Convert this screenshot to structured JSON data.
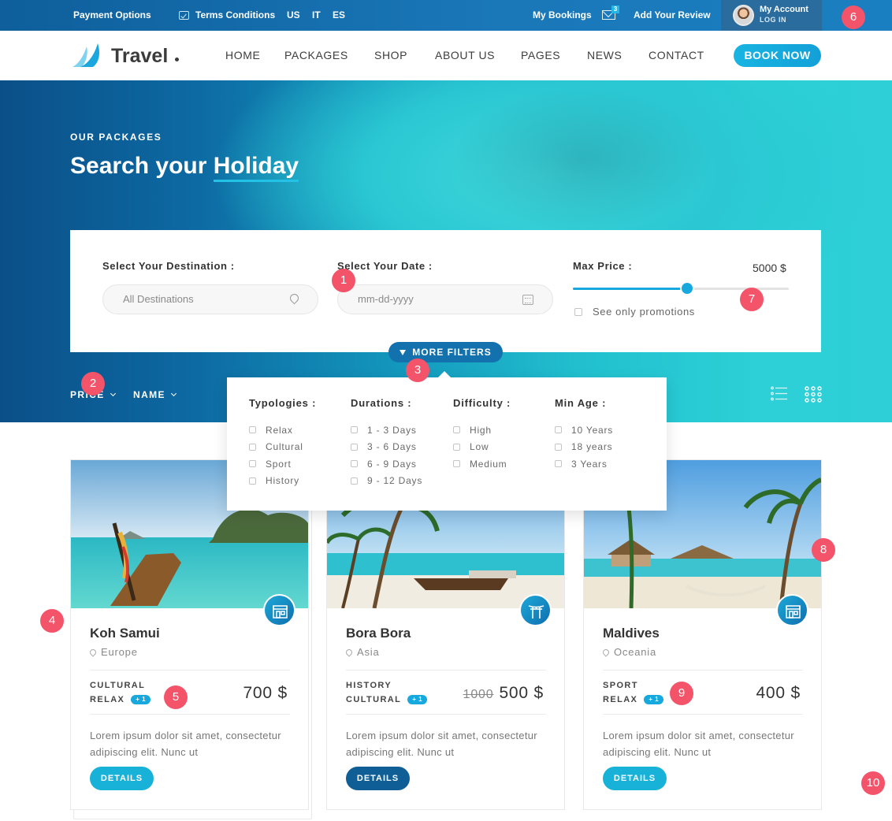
{
  "topbar": {
    "payment_label": "Payment Options",
    "terms_label": "Terms Conditions",
    "languages": [
      "US",
      "IT",
      "ES"
    ],
    "bookings_label": "My Bookings",
    "mail_count": "3",
    "review_label": "Add Your Review",
    "account_label": "My Account",
    "login_label": "LOG IN"
  },
  "nav": {
    "logo_text": "Travel",
    "links": [
      "HOME",
      "PACKAGES",
      "SHOP",
      "ABOUT US",
      "PAGES",
      "NEWS",
      "CONTACT"
    ],
    "cta_label": "BOOK NOW"
  },
  "hero": {
    "subtitle": "OUR PACKAGES",
    "title_plain": "Search your",
    "title_highlight": "Holiday"
  },
  "search": {
    "destination_label": "Select Your Destination :",
    "destination_value": "All Destinations",
    "date_label": "Select Your Date :",
    "date_placeholder": "mm-dd-yyyy",
    "price_label": "Max Price :",
    "price_value": "5000 $",
    "price_slider_fraction": 0.53,
    "promotions_label": "See only promotions",
    "more_filters_label": "MORE FILTERS"
  },
  "sort": {
    "price_label": "PRICE",
    "name_label": "NAME"
  },
  "filters": {
    "columns": [
      {
        "title": "Typologies :",
        "options": [
          "Relax",
          "Cultural",
          "Sport",
          "History"
        ]
      },
      {
        "title": "Durations :",
        "options": [
          "1 - 3 Days",
          "3 - 6 Days",
          "6 - 9 Days",
          "9 - 12 Days"
        ]
      },
      {
        "title": "Difficulty :",
        "options": [
          "High",
          "Low",
          "Medium"
        ]
      },
      {
        "title": "Min Age :",
        "options": [
          "10 Years",
          "18 years",
          "3 Years"
        ]
      }
    ]
  },
  "cards": [
    {
      "name": "Koh Samui",
      "location": "Europe",
      "tag1": "CULTURAL",
      "tag2": "RELAX",
      "more": "+ 1",
      "old_price": "",
      "price": "700 $",
      "description": "Lorem ipsum dolor sit amet, consectetur adipiscing elit. Nunc ut",
      "button": "DETAILS",
      "icon": "shop-icon"
    },
    {
      "name": "Bora Bora",
      "location": "Asia",
      "tag1": "HISTORY",
      "tag2": "CULTURAL",
      "more": "+ 1",
      "old_price": "1000",
      "price": "500 $",
      "description": "Lorem ipsum dolor sit amet, consectetur adipiscing elit. Nunc ut",
      "button": "DETAILS",
      "icon": "torii-gate-icon"
    },
    {
      "name": "Maldives",
      "location": "Oceania",
      "tag1": "SPORT",
      "tag2": "RELAX",
      "more": "+ 1",
      "old_price": "",
      "price": "400 $",
      "description": "Lorem ipsum dolor sit amet, consectetur adipiscing elit. Nunc ut",
      "button": "DETAILS",
      "icon": "shop-icon"
    }
  ],
  "markers": [
    "1",
    "2",
    "3",
    "4",
    "5",
    "6",
    "7",
    "8",
    "9",
    "10"
  ],
  "colors": {
    "primary": "#17a9dd",
    "dark_blue": "#1372ae",
    "marker": "#f4546a",
    "topbar": "#1a77b8"
  }
}
